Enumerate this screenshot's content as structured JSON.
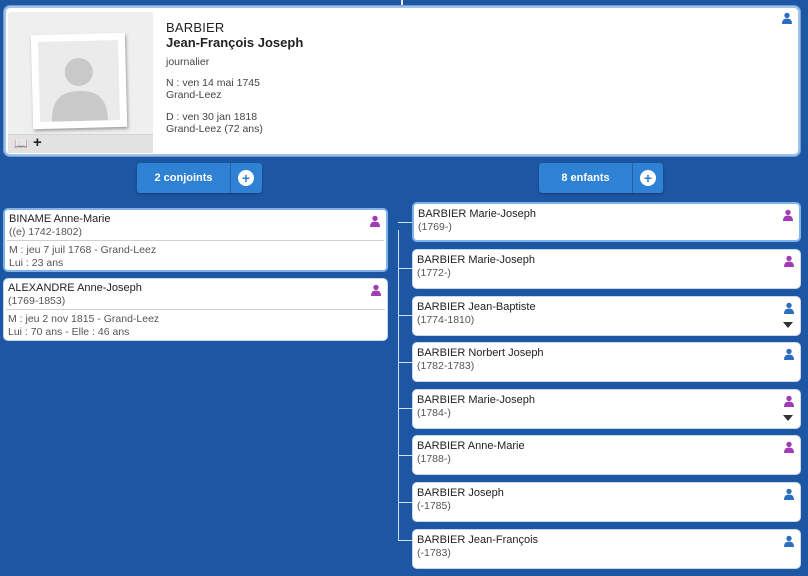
{
  "person": {
    "surname": "BARBIER",
    "given_names": "Jean-François Joseph",
    "occupation": "journalier",
    "birth_line": "N : ven 14 mai 1745",
    "birth_place": "Grand-Leez",
    "death_line": "D : ven 30 jan 1818",
    "death_place": "Grand-Leez (72 ans)",
    "gender": "male"
  },
  "icons": {
    "male_color": "#2d6fbf",
    "female_color": "#a03cb4",
    "book": "📖",
    "plus": "+"
  },
  "buttons": {
    "spouses_label": "2 conjoints",
    "children_label": "8 enfants",
    "add": "+"
  },
  "spouses": [
    {
      "name": "BINAME Anne-Marie",
      "dates": "((e) 1742-1802)",
      "marriage": "M : jeu 7 juil 1768 - Grand-Leez",
      "ages": "Lui : 23 ans",
      "gender": "female"
    },
    {
      "name": "ALEXANDRE Anne-Joseph",
      "dates": "(1769-1853)",
      "marriage": "M : jeu 2 nov 1815 - Grand-Leez",
      "ages": "Lui : 70 ans - Elle : 46 ans",
      "gender": "female"
    }
  ],
  "children": [
    {
      "name": "BARBIER Marie-Joseph",
      "dates": "(1769-)",
      "gender": "female",
      "expandable": false
    },
    {
      "name": "BARBIER Marie-Joseph",
      "dates": "(1772-)",
      "gender": "female",
      "expandable": false
    },
    {
      "name": "BARBIER Jean-Baptiste",
      "dates": "(1774-1810)",
      "gender": "male",
      "expandable": true
    },
    {
      "name": "BARBIER Norbert Joseph",
      "dates": "(1782-1783)",
      "gender": "male",
      "expandable": false
    },
    {
      "name": "BARBIER Marie-Joseph",
      "dates": "(1784-)",
      "gender": "female",
      "expandable": true
    },
    {
      "name": "BARBIER Anne-Marie",
      "dates": "(1788-)",
      "gender": "female",
      "expandable": false
    },
    {
      "name": "BARBIER Joseph",
      "dates": "(-1785)",
      "gender": "male",
      "expandable": false
    },
    {
      "name": "BARBIER Jean-François",
      "dates": "(-1783)",
      "gender": "male",
      "expandable": false
    }
  ]
}
